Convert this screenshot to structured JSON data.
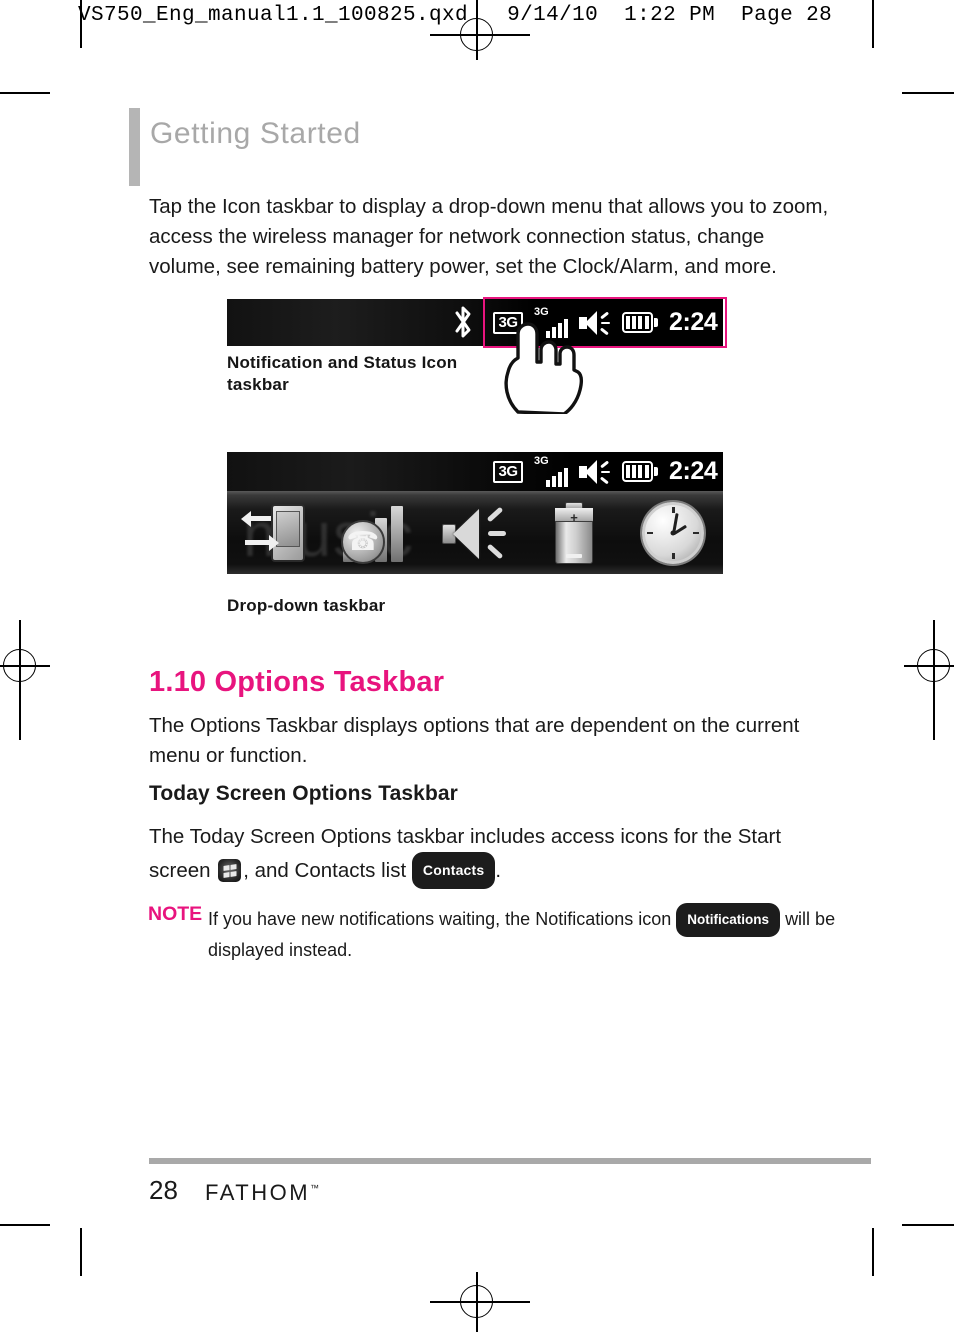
{
  "print_header": "VS750_Eng_manual1.1_100825.qxd   9/14/10  1:22 PM  Page 28",
  "chapter": {
    "title": "Getting Started"
  },
  "paragraphs": {
    "intro": "Tap the Icon taskbar to display a drop-down menu that allows you to zoom, access the wireless manager for network connection status, change volume, see remaining battery power, set the Clock/Alarm, and more.",
    "options_desc": "The Options Taskbar displays options that are dependent on the current menu or function.",
    "today_desc_before": "The Today Screen Options taskbar includes access icons for the Start screen",
    "today_desc_mid": ", and Contacts list",
    "today_desc_after": "."
  },
  "figure_one": {
    "caption": "Notification and Status Icon taskbar",
    "bluetooth_icon": "bluetooth-icon",
    "highlight_color": "#e8147e",
    "status_icons": {
      "notification_3g_box": "3G",
      "signal_label": "3G",
      "signal_bars": [
        7,
        11,
        15,
        19
      ],
      "speaker": "speaker-volume-icon",
      "battery": "battery-icon",
      "battery_segments": 4,
      "clock": "2:24"
    }
  },
  "figure_two": {
    "caption": "Drop-down taskbar",
    "wallpaper_text": "music",
    "status_icons": {
      "notification_3g_box": "3G",
      "signal_label": "3G",
      "signal_bars": [
        7,
        11,
        15,
        19
      ],
      "speaker": "speaker-volume-icon",
      "battery": "battery-icon",
      "battery_segments": 4,
      "clock": "2:24"
    },
    "tray_items": [
      {
        "name": "zoom-icon",
        "label": "Zoom"
      },
      {
        "name": "wireless-manager-icon",
        "label": "Wireless Manager"
      },
      {
        "name": "volume-icon",
        "label": "Volume"
      },
      {
        "name": "battery-power-icon",
        "label": "Battery Power"
      },
      {
        "name": "clock-alarm-icon",
        "label": "Clock / Alarm"
      }
    ]
  },
  "section": {
    "number_title": "1.10 Options Taskbar",
    "accent_color": "#e8147e",
    "subheading": "Today Screen Options Taskbar"
  },
  "badges": {
    "contacts": "Contacts",
    "notifications": "Notifications",
    "start_icon": "windows-start-icon"
  },
  "note": {
    "label": "NOTE",
    "text_before": "If you have new notifications waiting, the Notifications icon",
    "text_after": "will be displayed instead."
  },
  "footer": {
    "page_number": "28",
    "brand": "FATHOM",
    "trademark": "™"
  }
}
